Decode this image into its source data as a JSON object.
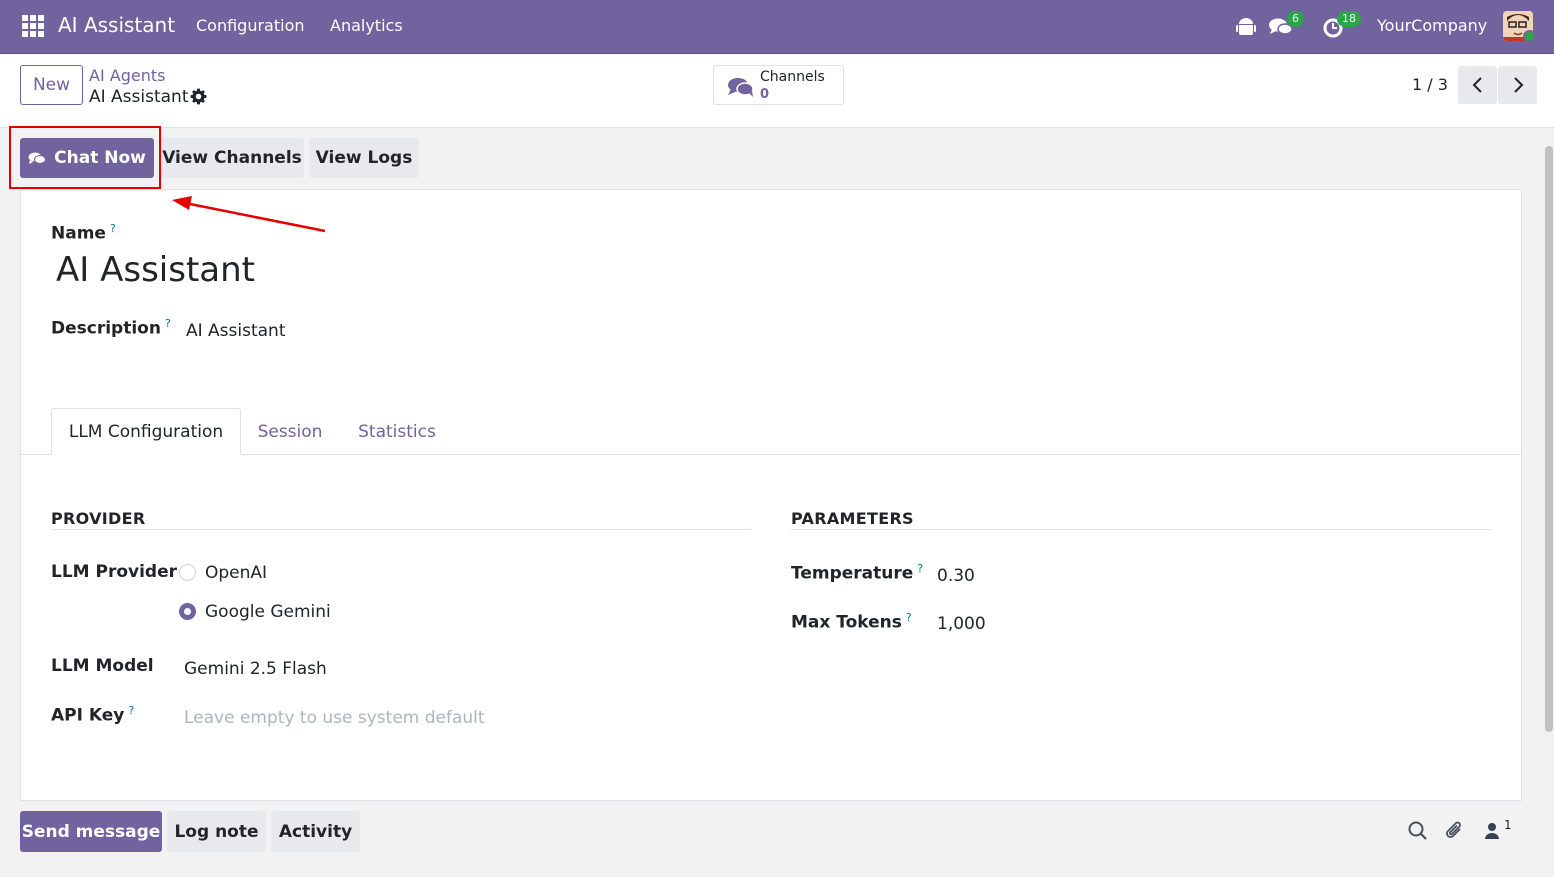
{
  "navbar": {
    "app_title": "AI Assistant",
    "menus": [
      "Configuration",
      "Analytics"
    ],
    "messages_badge": "6",
    "activities_badge": "18",
    "company": "YourCompany",
    "color": "#71639e"
  },
  "control_panel": {
    "new_label": "New",
    "breadcrumb_parent": "AI Agents",
    "breadcrumb_current": "AI Assistant",
    "smart_button": {
      "label": "Channels",
      "value": "0"
    },
    "pager": "1 / 3"
  },
  "actions": {
    "chat_now": "Chat Now",
    "view_channels": "View Channels",
    "view_logs": "View Logs"
  },
  "form": {
    "name_label": "Name",
    "name_value": "AI Assistant",
    "description_label": "Description",
    "description_value": "AI Assistant",
    "help_mark": "?",
    "tabs": [
      "LLM Configuration",
      "Session",
      "Statistics"
    ],
    "provider_section": "PROVIDER",
    "parameters_section": "PARAMETERS",
    "llm_provider_label": "LLM Provider",
    "provider_options": [
      {
        "label": "OpenAI",
        "checked": false
      },
      {
        "label": "Google Gemini",
        "checked": true
      }
    ],
    "llm_model_label": "LLM Model",
    "llm_model_value": "Gemini 2.5 Flash",
    "api_key_label": "API Key",
    "api_key_placeholder": "Leave empty to use system default",
    "temperature_label": "Temperature",
    "temperature_value": "0.30",
    "max_tokens_label": "Max Tokens",
    "max_tokens_value": "1,000"
  },
  "chatter": {
    "send_message": "Send message",
    "log_note": "Log note",
    "activity": "Activity",
    "followers": "1"
  },
  "annotation": {
    "highlight_color": "#e60000"
  }
}
